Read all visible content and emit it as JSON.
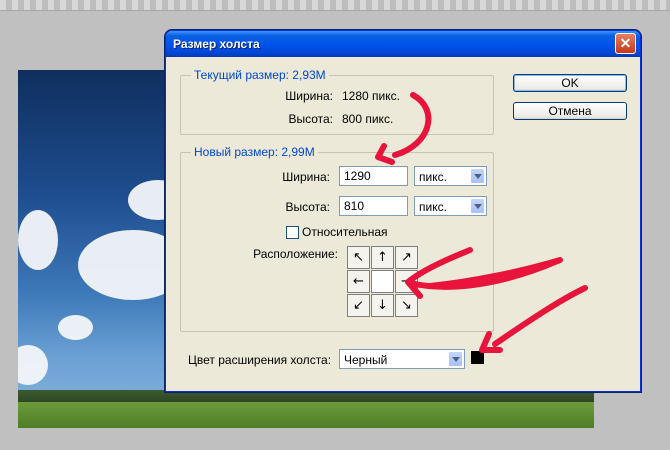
{
  "dialog": {
    "title": "Размер холста",
    "close_glyph": "✕"
  },
  "current_size": {
    "legend": "Текущий размер: 2,93M",
    "width_label": "Ширина:",
    "width_value": "1280 пикс.",
    "height_label": "Высота:",
    "height_value": "800 пикс."
  },
  "new_size": {
    "legend": "Новый размер: 2,99M",
    "width_label": "Ширина:",
    "width_value": "1290",
    "width_unit": "пикс.",
    "height_label": "Высота:",
    "height_value": "810",
    "height_unit": "пикс.",
    "relative_label": "Относительная",
    "relative_checked": false,
    "anchor_label": "Расположение:",
    "anchor_arrows": [
      "↖",
      "↑",
      "↗",
      "←",
      "",
      "→",
      "↙",
      "↓",
      "↘"
    ]
  },
  "extension": {
    "label": "Цвет расширения холста:",
    "selected": "Черный",
    "swatch_color": "#000000"
  },
  "buttons": {
    "ok": "OK",
    "cancel": "Отмена"
  },
  "colors": {
    "annotation": "#e8143c",
    "title_bar": "#0055ea"
  }
}
